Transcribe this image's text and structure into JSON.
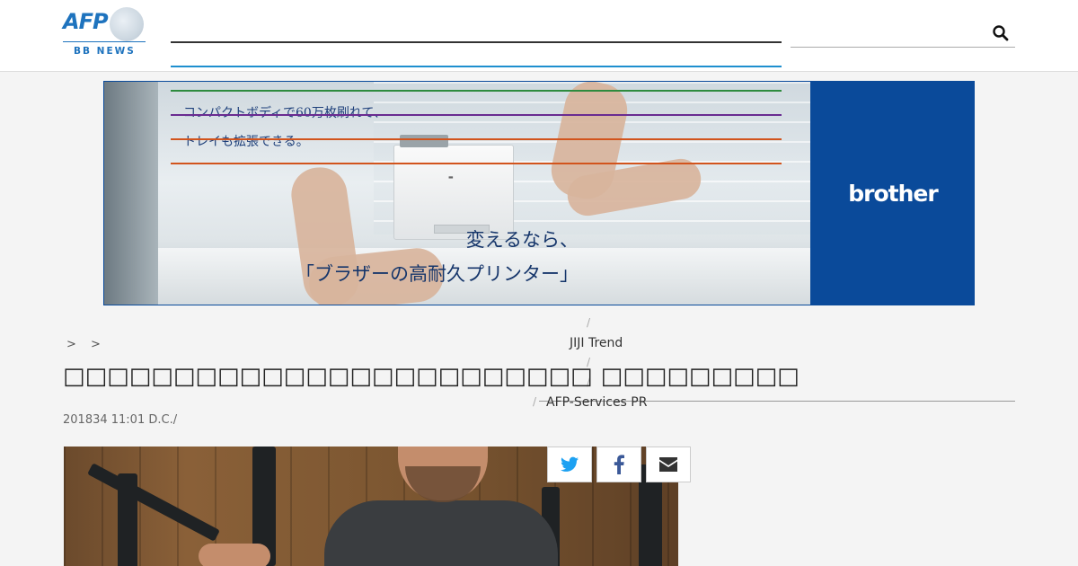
{
  "header": {
    "logo": {
      "brand": "AFP",
      "subtitle": "BB NEWS"
    },
    "nav_colors": [
      "#333333",
      "#1e8fcf",
      "#2e8b3e",
      "#6a2c91",
      "#d2541d",
      "#d2541d"
    ],
    "search": {
      "icon": "search-icon"
    }
  },
  "ad": {
    "copy_line1": "コンパクトボディで60万枚刷れて、",
    "copy_line2": "トレイも拡張できる。",
    "headline_line1": "変えるなら、",
    "headline_line2": "「ブラザーの高耐久プリンター」",
    "brand": "brother",
    "brand_color": "#0a4a9a"
  },
  "menu": {
    "item1": "JIJI Trend",
    "item2": "AFP-Services PR",
    "separator": "/"
  },
  "article": {
    "breadcrumb": "> >",
    "title": "□□□□□□□□□□□□□□□□□□□□□□□□ □□□□□□□□□",
    "dateline": "201834 11:01  D.C./"
  },
  "share": {
    "icons": [
      "twitter-icon",
      "facebook-icon",
      "email-icon"
    ],
    "twitter_color": "#1da1f2",
    "facebook_color": "#3b5998",
    "email_color": "#333333"
  }
}
